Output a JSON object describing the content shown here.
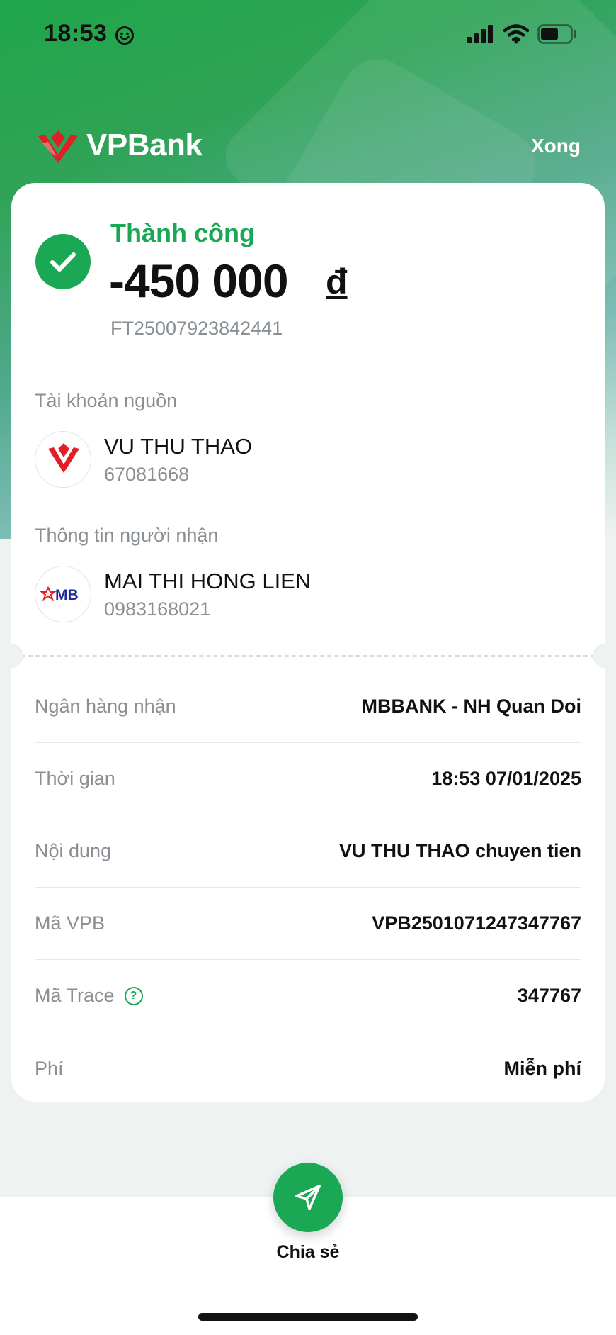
{
  "status_bar": {
    "time": "18:53"
  },
  "header": {
    "brand": "VPBank",
    "done_label": "Xong"
  },
  "transaction": {
    "status": "Thành công",
    "amount": "-450 000",
    "currency": "đ",
    "reference": "FT25007923842441"
  },
  "source": {
    "section_label": "Tài khoản nguồn",
    "name": "VU THU THAO",
    "account": "67081668"
  },
  "recipient": {
    "section_label": "Thông tin người nhận",
    "name": "MAI THI HONG LIEN",
    "account": "0983168021",
    "bank_logo_text": "MB"
  },
  "details": [
    {
      "label": "Ngân hàng nhận",
      "value": "MBBANK - NH Quan Doi"
    },
    {
      "label": "Thời gian",
      "value": "18:53 07/01/2025"
    },
    {
      "label": "Nội dung",
      "value": "VU THU THAO chuyen tien"
    },
    {
      "label": "Mã VPB",
      "value": "VPB2501071247347767"
    },
    {
      "label": "Mã Trace",
      "value": "347767"
    },
    {
      "label": "Phí",
      "value": "Miễn phí"
    }
  ],
  "actions": {
    "share_label": "Chia sẻ"
  },
  "colors": {
    "accent": "#1aa855",
    "brand_red": "#e41e26"
  }
}
